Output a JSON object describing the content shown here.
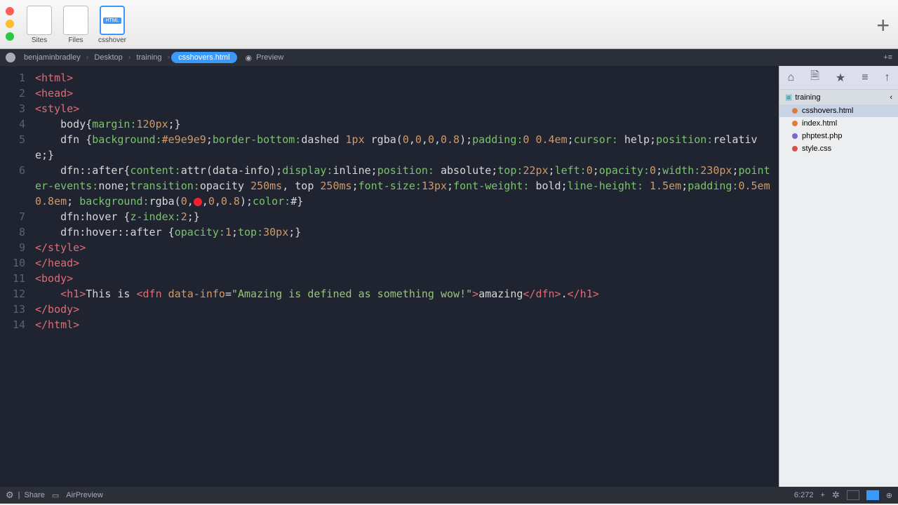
{
  "titlebar": {
    "tabs": [
      {
        "label": "Sites"
      },
      {
        "label": "Files"
      },
      {
        "label": "csshover",
        "badge": "HTML"
      }
    ],
    "active_tab": 2
  },
  "pathbar": {
    "crumbs": [
      "benjaminbradley",
      "Desktop",
      "training",
      "csshovers.html"
    ],
    "active": 3,
    "preview": "Preview"
  },
  "gutter": [
    "1",
    "2",
    "3",
    "4",
    "5",
    "6",
    "7",
    "8",
    "9",
    "10",
    "11",
    "12",
    "13",
    "14"
  ],
  "code_lines": {
    "l1": "<html>",
    "l2": "<head>",
    "l3": "<style>",
    "l4_indent": "    body{",
    "l4_prop": "margin:",
    "l4_val": "120px",
    "l4_end": ";}",
    "l5a": "    dfn {",
    "l5b": "background:",
    "l5c": "#e9e9e9",
    "l5d": ";",
    "l5e": "border-bottom:",
    "l5f": "dashed ",
    "l5g": "1px",
    "l5h": " rgba(",
    "l5i": "0",
    "l5j": ",",
    "l5k": "0",
    "l5l": ",",
    "l5m": "0",
    "l5n": ",",
    "l5o": "0.8",
    "l5p": ");",
    "l5q": "padding:",
    "l5r": "0 0.4em",
    "l5s": ";",
    "l5t": "cursor:",
    "l5u": " help;",
    "l5v": "position:",
    "l5w": "relative",
    "l5x": ";}",
    "l6a": "    dfn::after{",
    "l6b": "content:",
    "l6c": "attr(data-info);",
    "l6d": "display:",
    "l6e": "inline",
    "l6f": ";",
    "l6g": "position:",
    "l6h": " absolute;",
    "l6i": "top:",
    "l6j": "22px",
    "l6k": ";",
    "l6l": "left:",
    "l6m": "0",
    "l6n": ";",
    "l6o": "opacity:",
    "l6p": "0",
    "l6q": ";",
    "l6r": "width:",
    "l6s": "230px",
    "l6t": ";",
    "l6u": "pointer-events:",
    "l6v": "none",
    "l6w": ";",
    "l6x": "transition:",
    "l6y": "opacity ",
    "l6z": "250ms",
    "l6aa": ", top ",
    "l6ab": "250ms",
    "l6ac": ";",
    "l6ad": "font-size:",
    "l6ae": "13px",
    "l6af": ";",
    "l6ag": "font-weight:",
    "l6ah": " bold;",
    "l6ai": "line-height:",
    "l6aj": " 1.5em",
    "l6ak": ";",
    "l6al": "padding:",
    "l6am": "0.5em 0.8em",
    "l6an": "; ",
    "l6ao": "background:",
    "l6ap": "rgba(",
    "l6aq": "0",
    "l6ar": ",",
    "l6as": "0",
    "l6at": ",",
    "l6au": "0",
    "l6av": ",",
    "l6aw": "0.8",
    "l6ax": ");",
    "l6ay": "color:",
    "l6az": "#",
    "l6ba": "}",
    "l7a": "    dfn:hover {",
    "l7b": "z-index:",
    "l7c": "2",
    "l7d": ";}",
    "l8a": "    dfn:hover::after {",
    "l8b": "opacity:",
    "l8c": "1",
    "l8d": ";",
    "l8e": "top:",
    "l8f": "30px",
    "l8g": ";}",
    "l9": "</style>",
    "l10": "</head>",
    "l11": "<body>",
    "l12a": "    <h1>",
    "l12b": "This is ",
    "l12c": "<dfn ",
    "l12d": "data-info",
    "l12e": "=",
    "l12f": "\"Amazing is defined as something wow!\"",
    "l12g": ">",
    "l12h": "amazing",
    "l12i": "</dfn>",
    "l12j": ".",
    "l12k": "</h1>",
    "l13": "</body>",
    "l14": "</html>"
  },
  "sidepanel": {
    "folder": "training",
    "files": [
      {
        "name": "csshovers.html",
        "color": "#e07b3c",
        "selected": true
      },
      {
        "name": "index.html",
        "color": "#e07b3c",
        "selected": false
      },
      {
        "name": "phptest.php",
        "color": "#7b67c9",
        "selected": false
      },
      {
        "name": "style.css",
        "color": "#d94f4f",
        "selected": false
      }
    ]
  },
  "statusbar": {
    "share": "Share",
    "airpreview": "AirPreview",
    "pos": "6:272"
  }
}
